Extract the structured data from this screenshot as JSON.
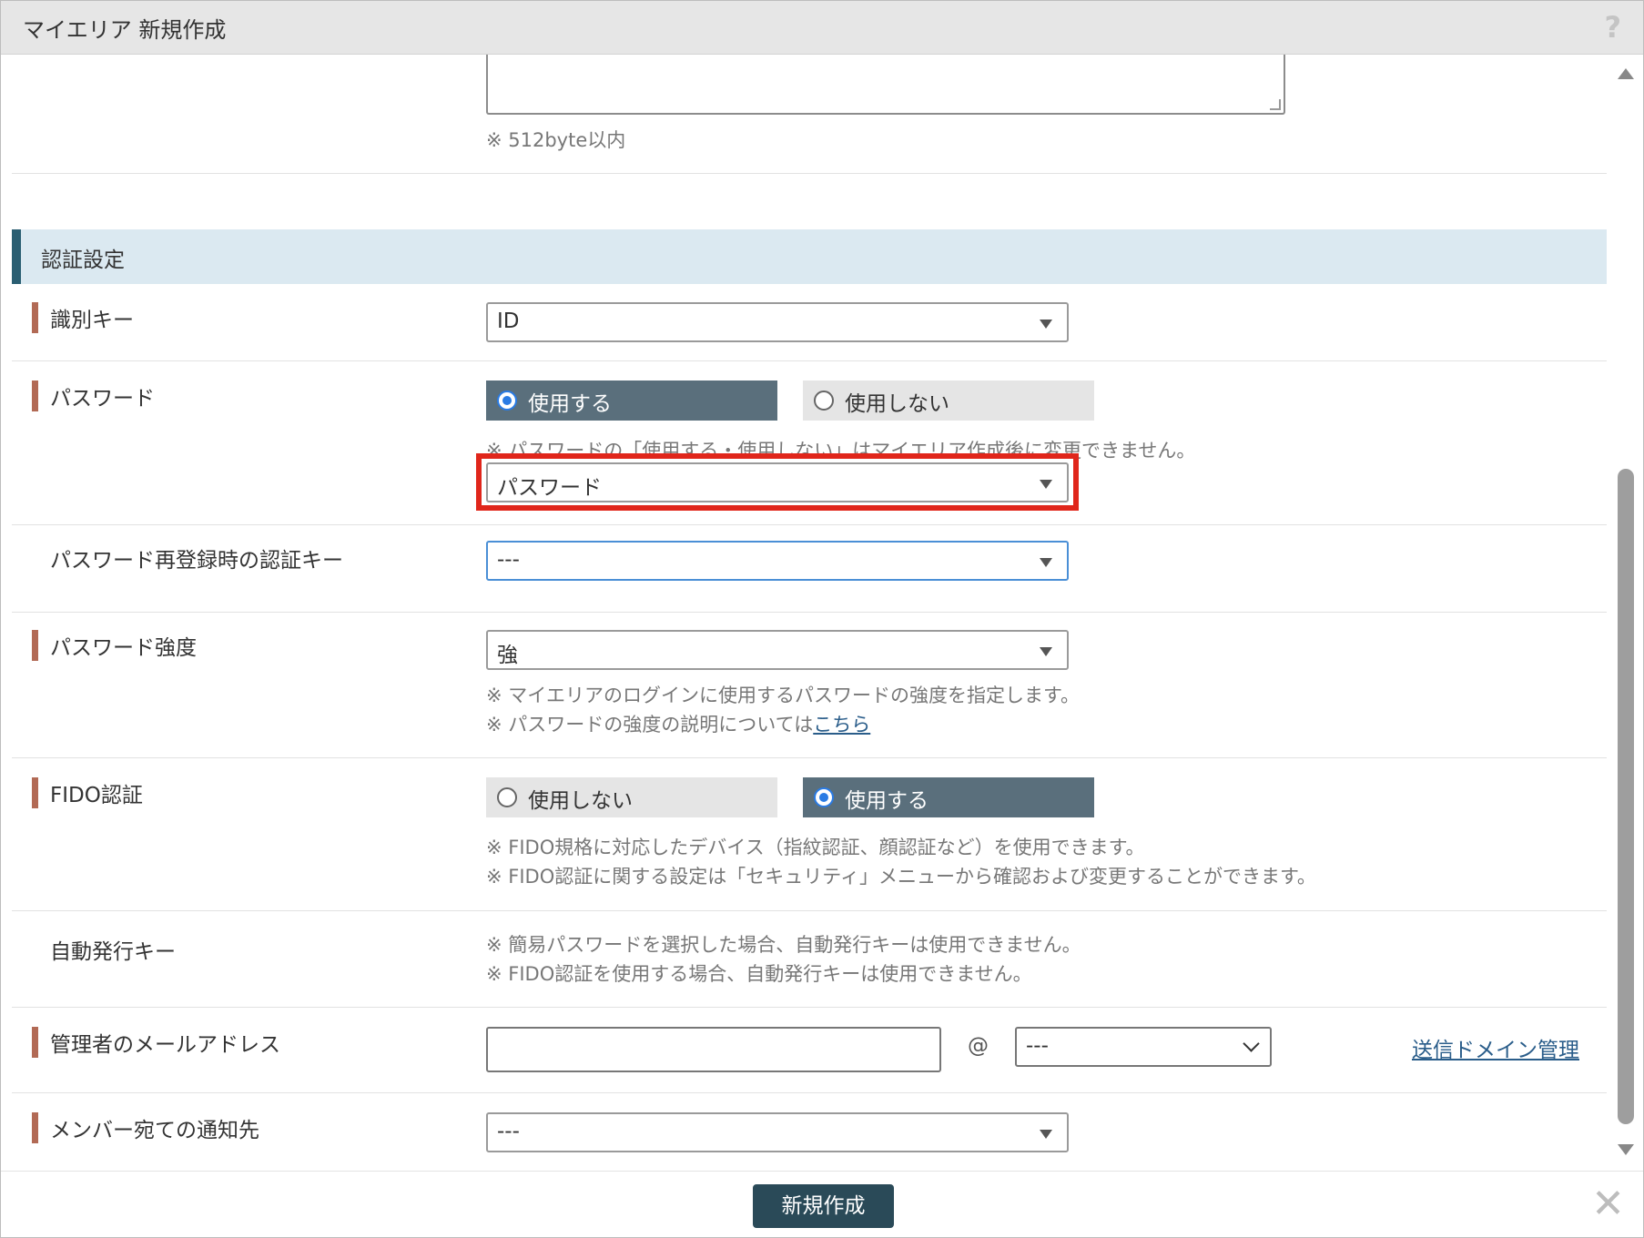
{
  "dialog": {
    "title": "マイエリア 新規作成",
    "help_icon": "?",
    "close_icon": "✕"
  },
  "top": {
    "textarea_value": "",
    "note": "※ 512byte以内"
  },
  "section": {
    "title": "認証設定"
  },
  "rows": {
    "identifier": {
      "label": "識別キー",
      "value": "ID"
    },
    "password": {
      "label": "パスワード",
      "option_use": "使用する",
      "option_no": "使用しない",
      "note": "※ パスワードの「使用する・使用しない」はマイエリア作成後に変更できません。",
      "type_value": "パスワード"
    },
    "reregister": {
      "label": "パスワード再登録時の認証キー",
      "value": "---"
    },
    "strength": {
      "label": "パスワード強度",
      "value": "強",
      "note1": "※ マイエリアのログインに使用するパスワードの強度を指定します。",
      "note2": "※ パスワードの強度の説明については",
      "note2_link": "こちら"
    },
    "fido": {
      "label": "FIDO認証",
      "option_no": "使用しない",
      "option_use": "使用する",
      "note1": "※ FIDO規格に対応したデバイス（指紋認証、顔認証など）を使用できます。",
      "note2": "※ FIDO認証に関する設定は「セキュリティ」メニューから確認および変更することができます。"
    },
    "autokey": {
      "label": "自動発行キー",
      "note1": "※ 簡易パスワードを選択した場合、自動発行キーは使用できません。",
      "note2": "※ FIDO認証を使用する場合、自動発行キーは使用できません。"
    },
    "admin_email": {
      "label": "管理者のメールアドレス",
      "local_value": "",
      "at": "@",
      "domain_value": "---",
      "domain_link": "送信ドメイン管理"
    },
    "notify": {
      "label": "メンバー宛ての通知先",
      "value": "---"
    }
  },
  "footer": {
    "create_label": "新規作成"
  }
}
